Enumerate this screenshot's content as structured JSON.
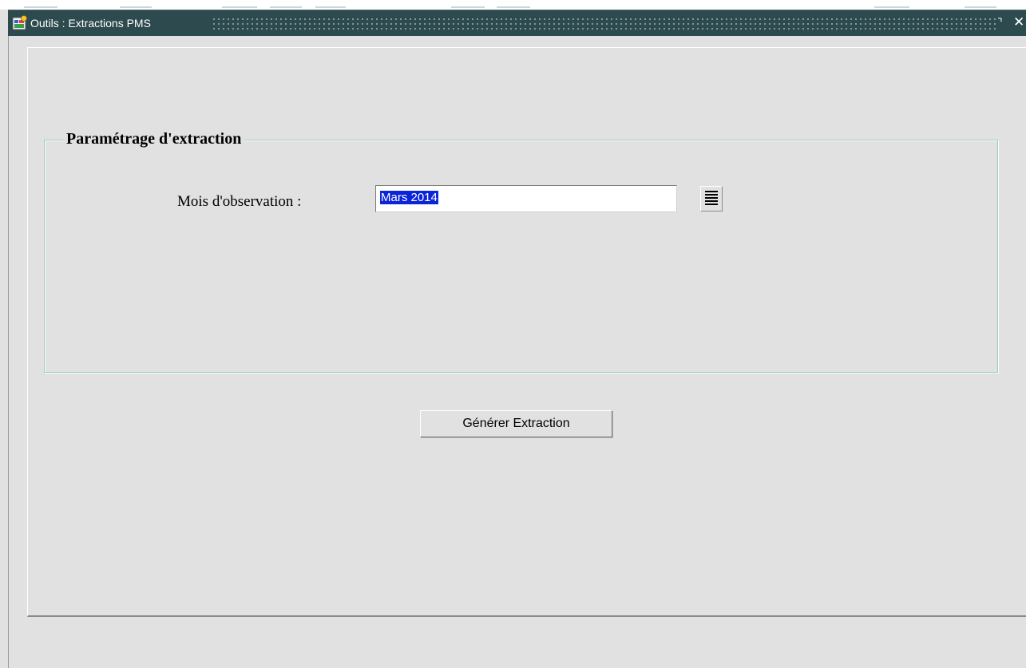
{
  "window": {
    "title": "Outils : Extractions PMS",
    "restore_glyph": "⌝",
    "close_glyph": "✕",
    "title_bar_color": "#2d4a4e"
  },
  "form": {
    "group_title": "Paramétrage d'extraction",
    "month_label": "Mois d'observation :",
    "month_value": "Mars 2014",
    "lov_icon": "list-icon",
    "generate_label": "Générer Extraction"
  },
  "colors": {
    "background": "#e1e1e1",
    "selection": "#0a24d8",
    "fieldset_border": "#98c8c8"
  }
}
